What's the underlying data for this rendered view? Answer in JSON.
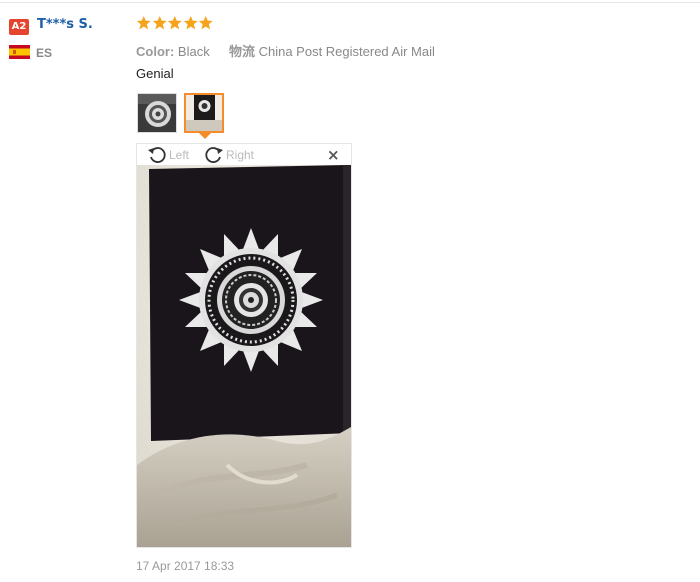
{
  "buyer": {
    "level": "A2",
    "name": "T***s S.",
    "country": "ES",
    "flag_colors": [
      "#c60b1e",
      "#ffc400"
    ]
  },
  "review": {
    "rating": 5,
    "star_color": "#f7a41d",
    "color_label": "Color:",
    "color_value": "Black",
    "shipping_label": "物流",
    "shipping_value": "China Post Registered Air Mail",
    "comment": "Genial",
    "date": "17 Apr 2017 18:33"
  },
  "viewer": {
    "rotate_left": "Left",
    "rotate_right": "Right",
    "close": "×",
    "selected_thumb": 2,
    "accent_color": "#f68b2c"
  }
}
